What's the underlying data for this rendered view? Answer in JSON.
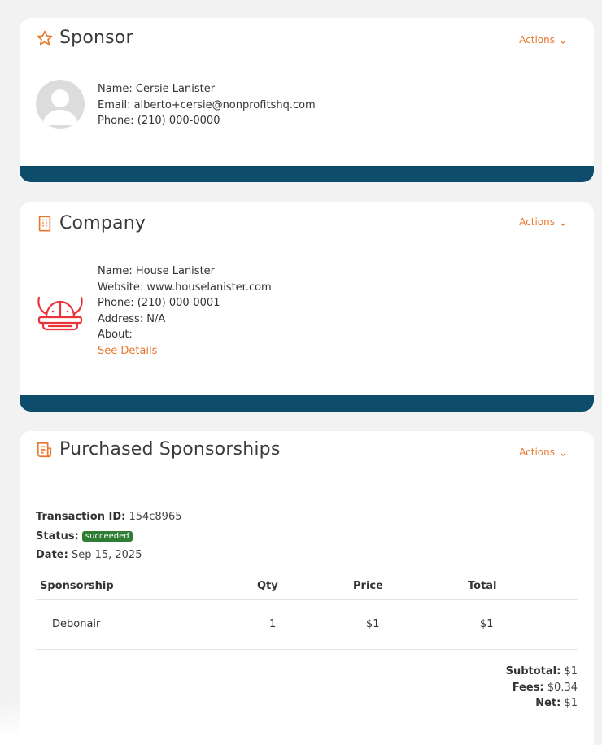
{
  "sponsor": {
    "title": "Sponsor",
    "actions_label": "Actions",
    "name": "Name: Cersie Lanister",
    "email": "Email: alberto+cersie@nonprofitshq.com",
    "phone": "Phone: (210) 000-0000"
  },
  "company": {
    "title": "Company",
    "actions_label": "Actions",
    "name": "Name: House Lanister",
    "website": "Website: www.houselanister.com",
    "phone": "Phone: (210) 000-0001",
    "address": "Address: N/A",
    "about": "About:",
    "details_link": "See Details"
  },
  "purchases": {
    "title": "Purchased Sponsorships",
    "actions_label": "Actions",
    "transaction_label": "Transaction ID:",
    "transaction_id": "154c8965",
    "status_label": "Status:",
    "status": "succeeded",
    "date_label": "Date:",
    "date": "Sep 15, 2025",
    "columns": [
      "Sponsorship",
      "Qty",
      "Price",
      "Total"
    ],
    "rows": [
      {
        "sponsorship": "Debonair",
        "qty": "1",
        "price": "$1",
        "total": "$1"
      }
    ],
    "subtotal_label": "Subtotal:",
    "subtotal": "$1",
    "fees_label": "Fees:",
    "fees": "$0.34",
    "net_label": "Net:",
    "net": "$1"
  },
  "colors": {
    "accent": "#e8772e",
    "footer_bar": "#0e4c6b",
    "status_success": "#2e7d32",
    "logo_red": "#e8343a"
  },
  "icons": {
    "sponsor": "star-icon",
    "company": "building-icon",
    "purchases": "receipt-icon",
    "actions": "chevron-down-icon"
  }
}
